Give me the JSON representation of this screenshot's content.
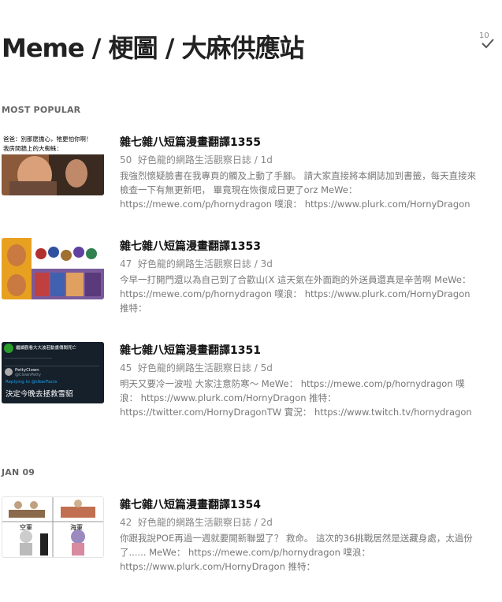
{
  "header": {
    "title": "Meme / 梗圖 / 大麻供應站",
    "unread_count": "10"
  },
  "sections": [
    {
      "label": "MOST POPULAR"
    },
    {
      "label": "JAN 09"
    }
  ],
  "cards": [
    {
      "title": "雜七雜八短篇漫畫翻譯1355",
      "count": "50",
      "source": "好色龍的網路生活觀察日誌",
      "age": "1d",
      "excerpt": "我強烈懷疑臉書在我專頁的觸及上動了手腳。 請大家直接將本網誌加到書籤，每天直接來檢查一下有無更新吧， 畢竟現在恢復成日更了orz MeWe： https://mewe.com/p/hornydragon 噗浪： https://www.plurk.com/HornyDragon",
      "thumb_text_1": "爸爸：別那麼擔心，牠更怕你啊！",
      "thumb_text_2": "我房間牆上的大蜘蛛："
    },
    {
      "title": "雜七雜八短篇漫畫翻譯1353",
      "count": "47",
      "source": "好色龍的網路生活觀察日誌",
      "age": "3d",
      "excerpt": "今早一打開門還以為自己到了合歡山(X 這天氣在外面跑的外送員還真是辛苦啊 MeWe： https://mewe.com/p/hornydragon 噗浪： https://www.plurk.com/HornyDragon 推特："
    },
    {
      "title": "雜七雜八短篇漫畫翻譯1351",
      "count": "45",
      "source": "好色龍的網路生活觀察日誌",
      "age": "5d",
      "excerpt": "明天又要冷一波啦 大家注意防寒～ MeWe： https://mewe.com/p/hornydragon 噗浪： https://www.plurk.com/HornyDragon 推特： https://twitter.com/HornyDragonTW 實況： https://www.twitch.tv/hornydragon",
      "thumb_text_1": "繼續觀看大大波若動畫傳聞死亡",
      "thumb_text_2": "PettyClown",
      "thumb_text_3": "@ClownPetty",
      "thumb_text_4": "Replying to @UberFacts",
      "thumb_text_5": "決定今晚去拯救雪貂"
    },
    {
      "title": "雜七雜八短篇漫畫翻譯1354",
      "count": "42",
      "source": "好色龍的網路生活觀察日誌",
      "age": "2d",
      "excerpt": "你跟我說POE再過一週就要開新聯盟了？ 救命。 這次的36挑戰居然是送藏身處，太過份了...... MeWe： https://mewe.com/p/hornydragon 噗浪： https://www.plurk.com/HornyDragon 推特：",
      "thumb_text_1": "空軍",
      "thumb_text_2": "海軍"
    }
  ],
  "colors": {
    "title": "#222222",
    "meta": "#888888",
    "excerpt": "#777777",
    "section": "#666666"
  }
}
